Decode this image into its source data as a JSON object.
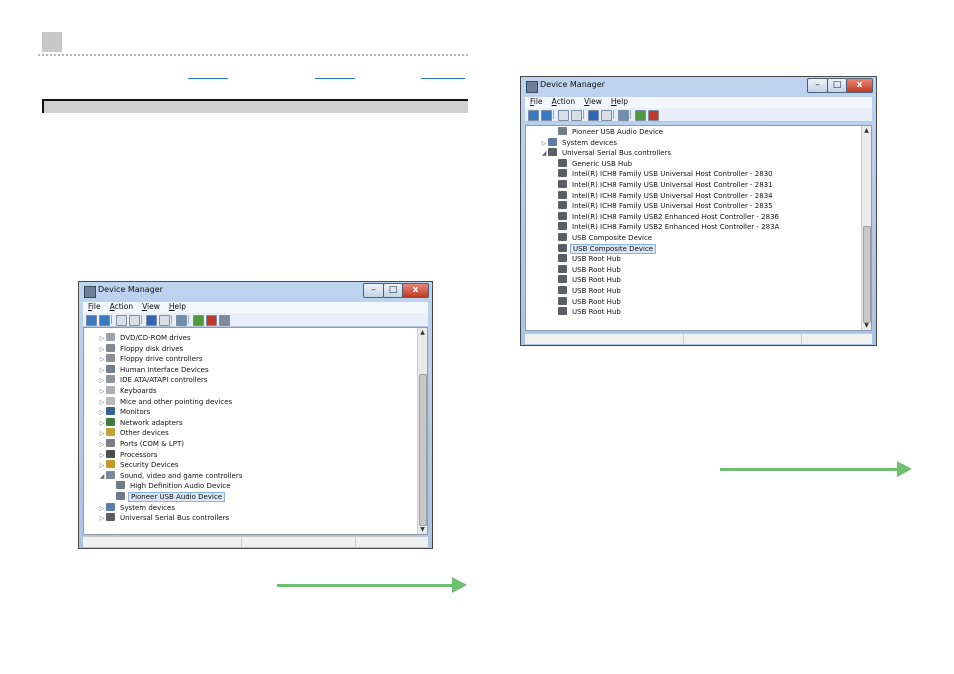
{
  "colors": {
    "arrow": "#6cc070",
    "selection": "#dbe8f8",
    "link_underline": "#2a7bc8"
  },
  "window_left": {
    "title": "Device Manager",
    "menu": [
      "File",
      "Action",
      "View",
      "Help"
    ],
    "toolbar_icons": [
      "back-icon",
      "forward-icon",
      "properties-icon",
      "show-hidden-icon",
      "help-icon",
      "grid-icon",
      "scan-hardware-icon",
      "update-driver-icon",
      "uninstall-icon",
      "disable-icon"
    ],
    "items": [
      {
        "label": "DVD/CD-ROM drives",
        "indent": 0,
        "expand": "collapsed",
        "icon": "dvd-drive-icon"
      },
      {
        "label": "Floppy disk drives",
        "indent": 0,
        "expand": "collapsed",
        "icon": "floppy-disk-icon"
      },
      {
        "label": "Floppy drive controllers",
        "indent": 0,
        "expand": "collapsed",
        "icon": "floppy-controller-icon"
      },
      {
        "label": "Human Interface Devices",
        "indent": 0,
        "expand": "collapsed",
        "icon": "hid-icon"
      },
      {
        "label": "IDE ATA/ATAPI controllers",
        "indent": 0,
        "expand": "collapsed",
        "icon": "ide-controller-icon"
      },
      {
        "label": "Keyboards",
        "indent": 0,
        "expand": "collapsed",
        "icon": "keyboard-icon"
      },
      {
        "label": "Mice and other pointing devices",
        "indent": 0,
        "expand": "collapsed",
        "icon": "mouse-icon"
      },
      {
        "label": "Monitors",
        "indent": 0,
        "expand": "collapsed",
        "icon": "monitor-icon"
      },
      {
        "label": "Network adapters",
        "indent": 0,
        "expand": "collapsed",
        "icon": "network-adapter-icon"
      },
      {
        "label": "Other devices",
        "indent": 0,
        "expand": "collapsed",
        "icon": "other-device-icon"
      },
      {
        "label": "Ports (COM & LPT)",
        "indent": 0,
        "expand": "collapsed",
        "icon": "port-icon"
      },
      {
        "label": "Processors",
        "indent": 0,
        "expand": "collapsed",
        "icon": "processor-icon"
      },
      {
        "label": "Security Devices",
        "indent": 0,
        "expand": "collapsed",
        "icon": "security-device-icon"
      },
      {
        "label": "Sound, video and game controllers",
        "indent": 0,
        "expand": "expanded",
        "icon": "sound-icon"
      },
      {
        "label": "High Definition Audio Device",
        "indent": 1,
        "expand": "none",
        "icon": "speaker-icon"
      },
      {
        "label": "Pioneer USB Audio Device",
        "indent": 1,
        "expand": "none",
        "icon": "speaker-icon",
        "selected": true
      },
      {
        "label": "System devices",
        "indent": 0,
        "expand": "collapsed",
        "icon": "system-device-icon"
      },
      {
        "label": "Universal Serial Bus controllers",
        "indent": 0,
        "expand": "collapsed",
        "icon": "usb-icon"
      }
    ]
  },
  "window_right": {
    "title": "Device Manager",
    "menu": [
      "File",
      "Action",
      "View",
      "Help"
    ],
    "toolbar_icons": [
      "back-icon",
      "forward-icon",
      "properties-icon",
      "show-hidden-icon",
      "help-icon",
      "grid-icon",
      "scan-hardware-icon",
      "update-driver-icon",
      "uninstall-icon"
    ],
    "items": [
      {
        "label": "Pioneer USB Audio Device",
        "indent": 1,
        "expand": "none",
        "icon": "speaker-icon"
      },
      {
        "label": "System devices",
        "indent": 0,
        "expand": "collapsed",
        "icon": "system-device-icon"
      },
      {
        "label": "Universal Serial Bus controllers",
        "indent": 0,
        "expand": "expanded",
        "icon": "usb-icon"
      },
      {
        "label": "Generic USB Hub",
        "indent": 1,
        "expand": "none",
        "icon": "usb-icon"
      },
      {
        "label": "Intel(R) ICH8 Family USB Universal Host Controller - 2830",
        "indent": 1,
        "expand": "none",
        "icon": "usb-icon"
      },
      {
        "label": "Intel(R) ICH8 Family USB Universal Host Controller - 2831",
        "indent": 1,
        "expand": "none",
        "icon": "usb-icon"
      },
      {
        "label": "Intel(R) ICH8 Family USB Universal Host Controller - 2834",
        "indent": 1,
        "expand": "none",
        "icon": "usb-icon"
      },
      {
        "label": "Intel(R) ICH8 Family USB Universal Host Controller - 2835",
        "indent": 1,
        "expand": "none",
        "icon": "usb-icon"
      },
      {
        "label": "Intel(R) ICH8 Family USB2 Enhanced Host Controller - 2836",
        "indent": 1,
        "expand": "none",
        "icon": "usb-icon"
      },
      {
        "label": "Intel(R) ICH8 Family USB2 Enhanced Host Controller - 283A",
        "indent": 1,
        "expand": "none",
        "icon": "usb-icon"
      },
      {
        "label": "USB Composite Device",
        "indent": 1,
        "expand": "none",
        "icon": "usb-icon"
      },
      {
        "label": "USB Composite Device",
        "indent": 1,
        "expand": "none",
        "icon": "usb-icon",
        "selected": true
      },
      {
        "label": "USB Root Hub",
        "indent": 1,
        "expand": "none",
        "icon": "usb-icon"
      },
      {
        "label": "USB Root Hub",
        "indent": 1,
        "expand": "none",
        "icon": "usb-icon"
      },
      {
        "label": "USB Root Hub",
        "indent": 1,
        "expand": "none",
        "icon": "usb-icon"
      },
      {
        "label": "USB Root Hub",
        "indent": 1,
        "expand": "none",
        "icon": "usb-icon"
      },
      {
        "label": "USB Root Hub",
        "indent": 1,
        "expand": "none",
        "icon": "usb-icon"
      },
      {
        "label": "USB Root Hub",
        "indent": 1,
        "expand": "none",
        "icon": "usb-icon"
      }
    ]
  }
}
